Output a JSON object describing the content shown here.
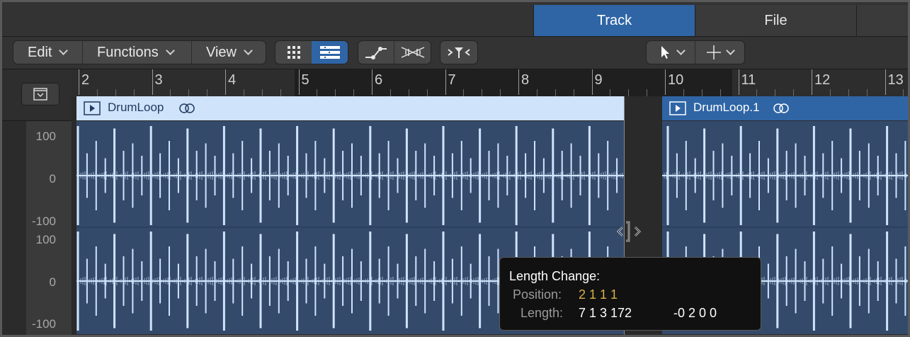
{
  "tabs": {
    "track": "Track",
    "file": "File"
  },
  "toolbar": {
    "edit": "Edit",
    "functions": "Functions",
    "view": "View"
  },
  "ruler": {
    "bars": [
      "2",
      "3",
      "4",
      "5",
      "6",
      "7",
      "8",
      "9",
      "10",
      "11",
      "12",
      "13"
    ]
  },
  "amplitude": {
    "labels": [
      "100",
      "0",
      "-100",
      "100",
      "0",
      "-100"
    ]
  },
  "regions": [
    {
      "name": "DrumLoop",
      "selected": false,
      "color": "#cfe3fb"
    },
    {
      "name": "DrumLoop.1",
      "selected": true,
      "color": "#2f65a5"
    }
  ],
  "tooltip": {
    "title": "Length Change:",
    "position_label": "Position:",
    "position_value": "2 1 1 1",
    "length_label": "Length:",
    "length_value": "7 1 3 172",
    "delta_value": "-0 2 0 0"
  },
  "colors": {
    "accent": "#2f65a5",
    "waveform": "#cfe3fb",
    "region_body": "#344a6b",
    "position_value": "#d8b24a"
  }
}
